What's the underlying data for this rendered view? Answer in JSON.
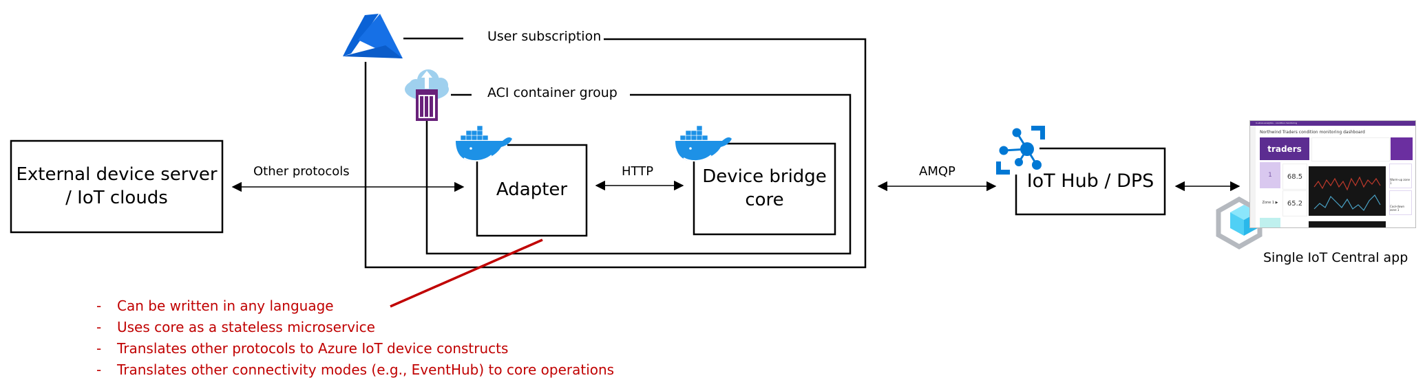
{
  "diagram": {
    "nodes": {
      "external": "External device server\n/ IoT clouds",
      "adapter": "Adapter",
      "core": "Device bridge\ncore",
      "iothub": "IoT Hub / DPS",
      "central": "Single IoT Central app"
    },
    "groups": {
      "subscription": "User subscription",
      "aci": "ACI container group"
    },
    "edges": {
      "other_protocols": "Other protocols",
      "http": "HTTP",
      "amqp": "AMQP"
    },
    "icons": {
      "azure": "azure-logo-icon",
      "aci": "aci-container-icon",
      "docker": "docker-whale-icon",
      "iothub": "iot-hub-icon",
      "central": "iot-central-icon"
    },
    "adapter_notes": [
      "Can be written in any language",
      "Uses core as a stateless microservice",
      "Translates other protocols to Azure IoT device constructs",
      "Translates other connectivity modes (e.g., EventHub) to core operations"
    ],
    "note_bullet": "-",
    "colors": {
      "note": "#c00000",
      "azure_blue": "#0a62d6",
      "docker_blue": "#1d91e6",
      "aci_purple": "#68217a",
      "aci_cloud": "#9fd0ee",
      "iot_blue": "#0078d4",
      "central_cube": "#50d0f5"
    }
  },
  "dashboard_thumbnail": {
    "app_bar": "In-store analytics - condition monitoring",
    "title": "Northwind Traders condition monitoring dashboard",
    "brand": "traders",
    "zone_number": "1",
    "zone_label": "Zone 1 ▶",
    "temperature": "68.5",
    "humidity": "65.2",
    "card1": "Warm-up zone 1",
    "card2": "Cool-down zone 1"
  }
}
